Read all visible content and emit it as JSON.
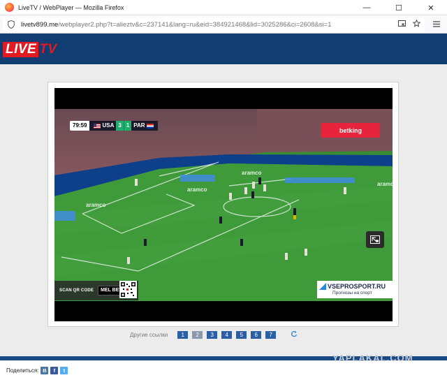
{
  "window": {
    "title": "LiveTV / WebPlayer — Mozilla Firefox",
    "minimize": "—",
    "maximize": "☐",
    "close": "✕"
  },
  "address": {
    "domain": "livetv899.me",
    "path": "/webplayer2.php?t=alieztv&c=237141&lang=ru&eid=384921468&lid=3025286&ci=2608&si=1"
  },
  "site": {
    "logo_live": "LIVE",
    "logo_tv": "TV"
  },
  "player": {
    "scoreboard": {
      "time": "79:59",
      "home": "USA",
      "home_score": "3",
      "away_score": "1",
      "away": "PAR"
    },
    "ads": {
      "betking": "betking",
      "scan": "SCAN QR CODE",
      "melbet": "MEL BET",
      "vseprosport": "VSEPROSPORT.RU",
      "vseprosport_sub": "Прогнозы на спорт"
    }
  },
  "links": {
    "label": "Другие ссылки",
    "pages": [
      "1",
      "2",
      "3",
      "4",
      "5",
      "6",
      "7"
    ],
    "active_page": "2"
  },
  "watermark": "YAPLAKAL.COM",
  "footer": {
    "share_label": "Поделиться:",
    "vk": "B",
    "fb": "f",
    "tw": "t"
  },
  "colors": {
    "header": "#123d72",
    "logo_red": "#e21b23",
    "page_button": "#2a5fa5"
  }
}
